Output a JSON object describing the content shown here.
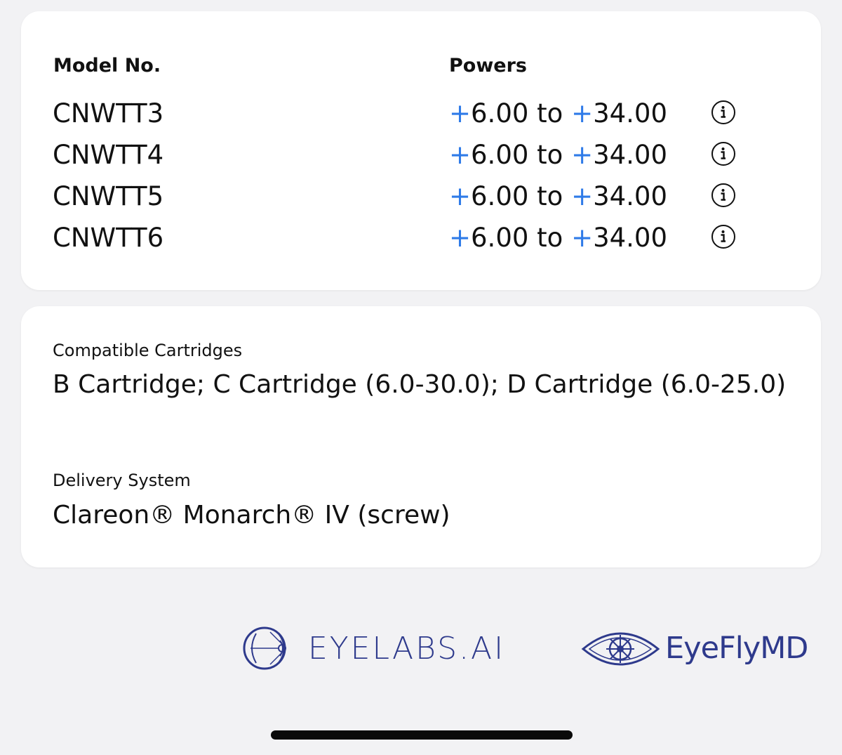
{
  "models_table": {
    "header_model": "Model No.",
    "header_powers": "Powers",
    "rows": [
      {
        "model": "CNWTT3",
        "plus_min": "+",
        "min": "6.00",
        "sep": " to ",
        "plus_max": "+",
        "max": "34.00"
      },
      {
        "model": "CNWTT4",
        "plus_min": "+",
        "min": "6.00",
        "sep": " to ",
        "plus_max": "+",
        "max": "34.00"
      },
      {
        "model": "CNWTT5",
        "plus_min": "+",
        "min": "6.00",
        "sep": " to ",
        "plus_max": "+",
        "max": "34.00"
      },
      {
        "model": "CNWTT6",
        "plus_min": "+",
        "min": "6.00",
        "sep": " to ",
        "plus_max": "+",
        "max": "34.00"
      }
    ]
  },
  "compatibility": {
    "cartridges_label": "Compatible Cartridges",
    "cartridges_value": "B Cartridge; C Cartridge (6.0-30.0); D Cartridge (6.0-25.0)",
    "delivery_label": "Delivery System",
    "delivery_value": "Clareon® Monarch® IV (screw)"
  },
  "logos": {
    "eyelabs": "EYELABS.AI",
    "eyefly": "EyeFlyMD"
  },
  "colors": {
    "accent_plus": "#2f7be8",
    "logo_blue": "#2e3a8c"
  },
  "icons": {
    "row_action": "info-icon",
    "eyelabs_mark": "eye-outline-icon",
    "eyefly_mark": "eye-ship-wheel-icon"
  }
}
